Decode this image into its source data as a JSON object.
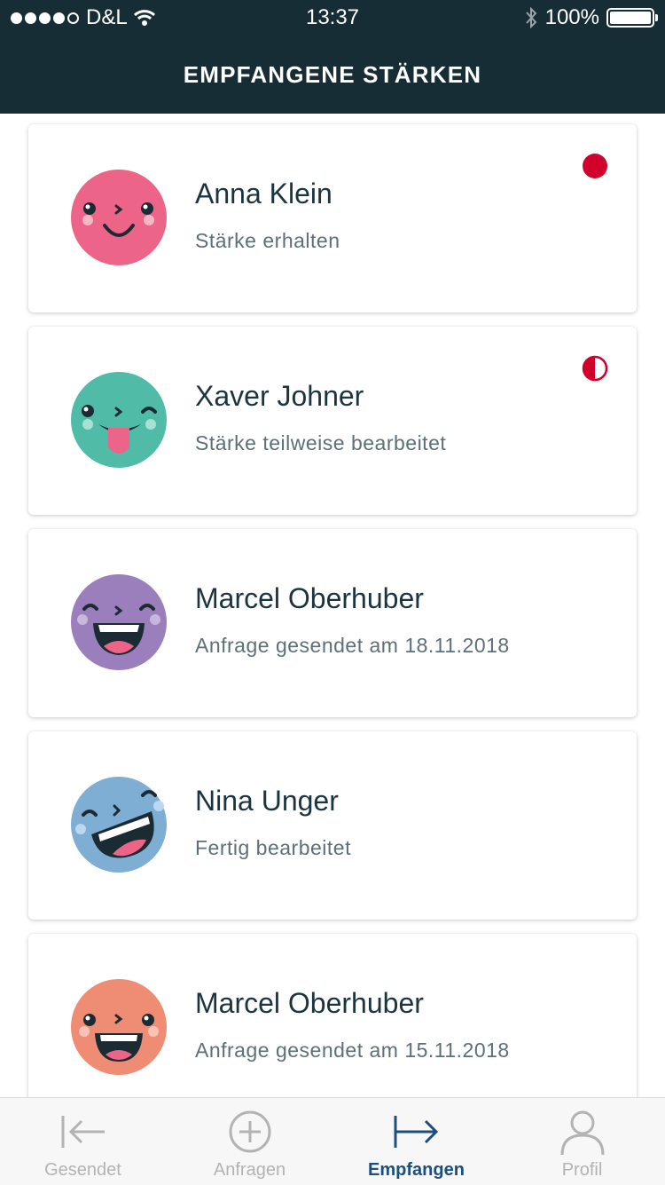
{
  "status_bar": {
    "carrier": "D&L",
    "time": "13:37",
    "battery": "100%"
  },
  "header": {
    "title": "EMPFANGENE STÄRKEN"
  },
  "cards": [
    {
      "name": "Anna Klein",
      "status": "Stärke erhalten",
      "avatar_color": "#ec6589",
      "indicator": "full"
    },
    {
      "name": "Xaver Johner",
      "status": "Stärke teilweise bearbeitet",
      "avatar_color": "#50bca8",
      "indicator": "half"
    },
    {
      "name": "Marcel Oberhuber",
      "status": "Anfrage gesendet am 18.11.2018",
      "avatar_color": "#9b7fbd",
      "indicator": "none"
    },
    {
      "name": "Nina Unger",
      "status": "Fertig bearbeitet",
      "avatar_color": "#7eaed4",
      "indicator": "none"
    },
    {
      "name": "Marcel Oberhuber",
      "status": "Anfrage gesendet am 15.11.2018",
      "avatar_color": "#ef8c74",
      "indicator": "none"
    }
  ],
  "tabs": [
    {
      "label": "Gesendet",
      "icon": "arrow-left-bar-icon",
      "active": false
    },
    {
      "label": "Anfragen",
      "icon": "plus-circle-icon",
      "active": false
    },
    {
      "label": "Empfangen",
      "icon": "arrow-right-bar-icon",
      "active": true
    },
    {
      "label": "Profil",
      "icon": "person-icon",
      "active": false
    }
  ],
  "colors": {
    "header_bg": "#172d36",
    "indicator_red": "#d0022b",
    "active_tab": "#1d4f7c",
    "inactive_tab": "#b3b3b3"
  }
}
